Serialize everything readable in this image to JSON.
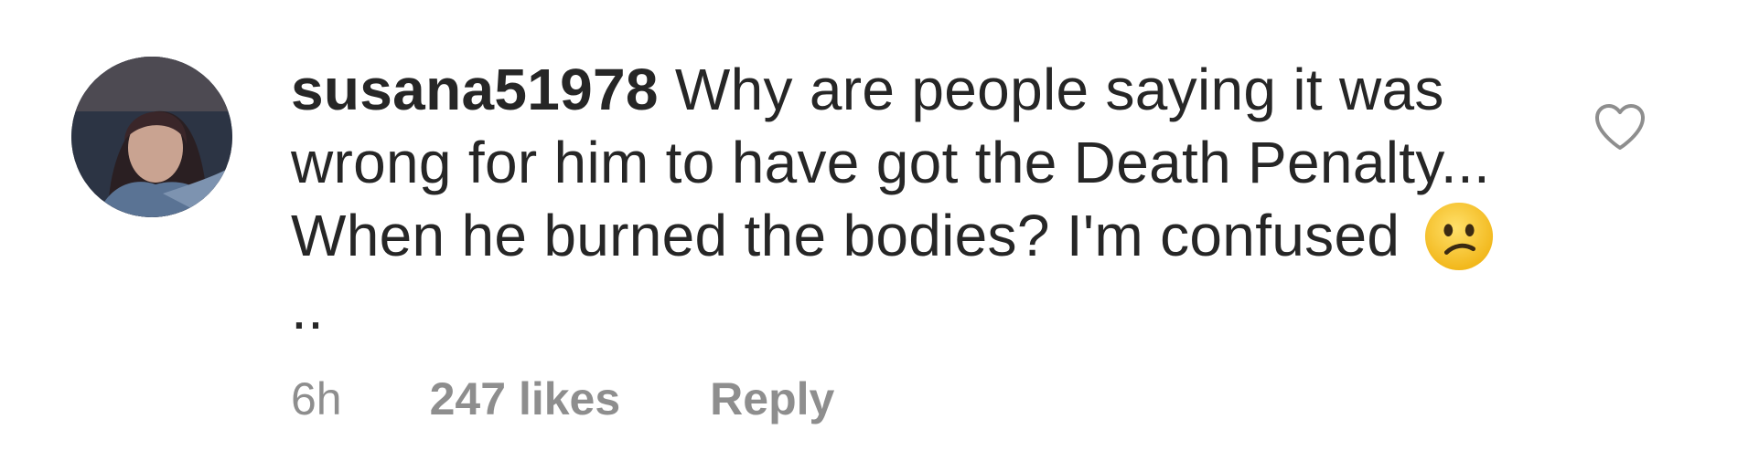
{
  "comment": {
    "username": "susana51978",
    "text_before_emoji": " Why are people saying it was wrong for him to have got the Death Penalty... When he burned the bodies? I'm confused ",
    "emoji": "confused-face",
    "text_after_emoji": "..",
    "time": "6h",
    "likes": "247 likes",
    "reply_label": "Reply",
    "like_icon": "heart-outline-icon"
  },
  "colors": {
    "text": "#262626",
    "meta": "#8e8e8e",
    "emoji": "#f5c322"
  }
}
